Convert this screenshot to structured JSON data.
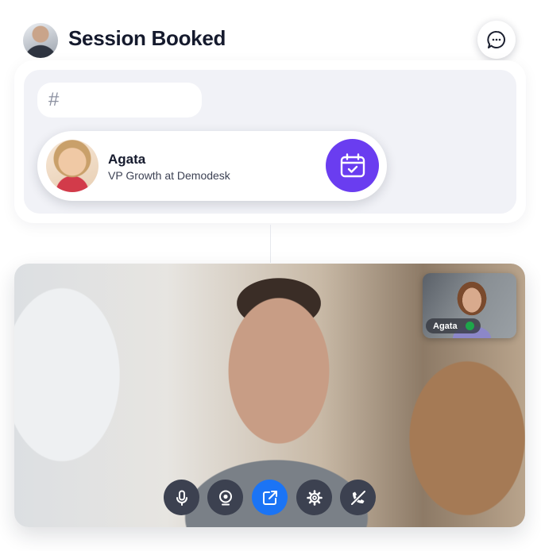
{
  "header": {
    "title": "Session Booked"
  },
  "composer": {
    "hash_symbol": "#"
  },
  "contact": {
    "name": "Agata",
    "role": "VP Growth at Demodesk"
  },
  "video": {
    "participant_label": "Agata",
    "participant_status": "online"
  },
  "colors": {
    "calendar_accent": "#6a3df0",
    "active_control": "#1b74f5",
    "online_status": "#1ea64a"
  },
  "icons": {
    "chat": "chat-bubble-icon",
    "calendar": "calendar-check-icon",
    "controls": [
      "microphone-icon",
      "webcam-icon",
      "share-screen-icon",
      "settings-icon",
      "end-call-icon"
    ]
  }
}
